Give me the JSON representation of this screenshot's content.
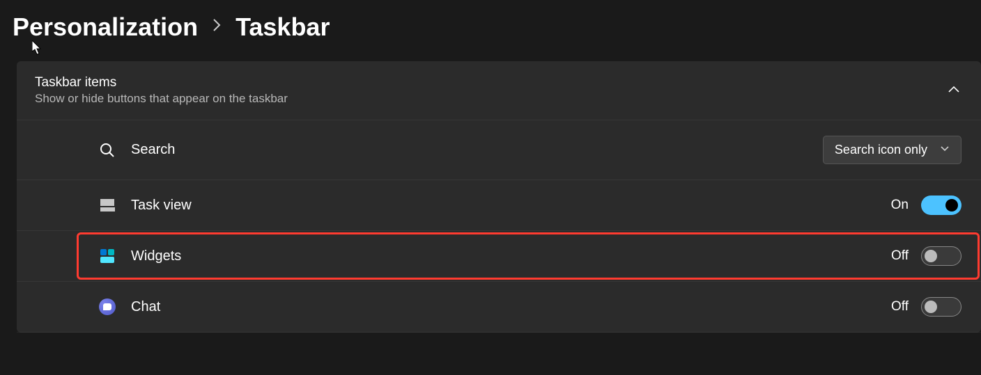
{
  "breadcrumb": {
    "parent": "Personalization",
    "current": "Taskbar"
  },
  "section": {
    "title": "Taskbar items",
    "subtitle": "Show or hide buttons that appear on the taskbar"
  },
  "items": {
    "search": {
      "label": "Search",
      "control_type": "dropdown",
      "value": "Search icon only"
    },
    "taskview": {
      "label": "Task view",
      "control_type": "toggle",
      "state_label": "On",
      "state": true
    },
    "widgets": {
      "label": "Widgets",
      "control_type": "toggle",
      "state_label": "Off",
      "state": false,
      "highlighted": true
    },
    "chat": {
      "label": "Chat",
      "control_type": "toggle",
      "state_label": "Off",
      "state": false
    }
  }
}
